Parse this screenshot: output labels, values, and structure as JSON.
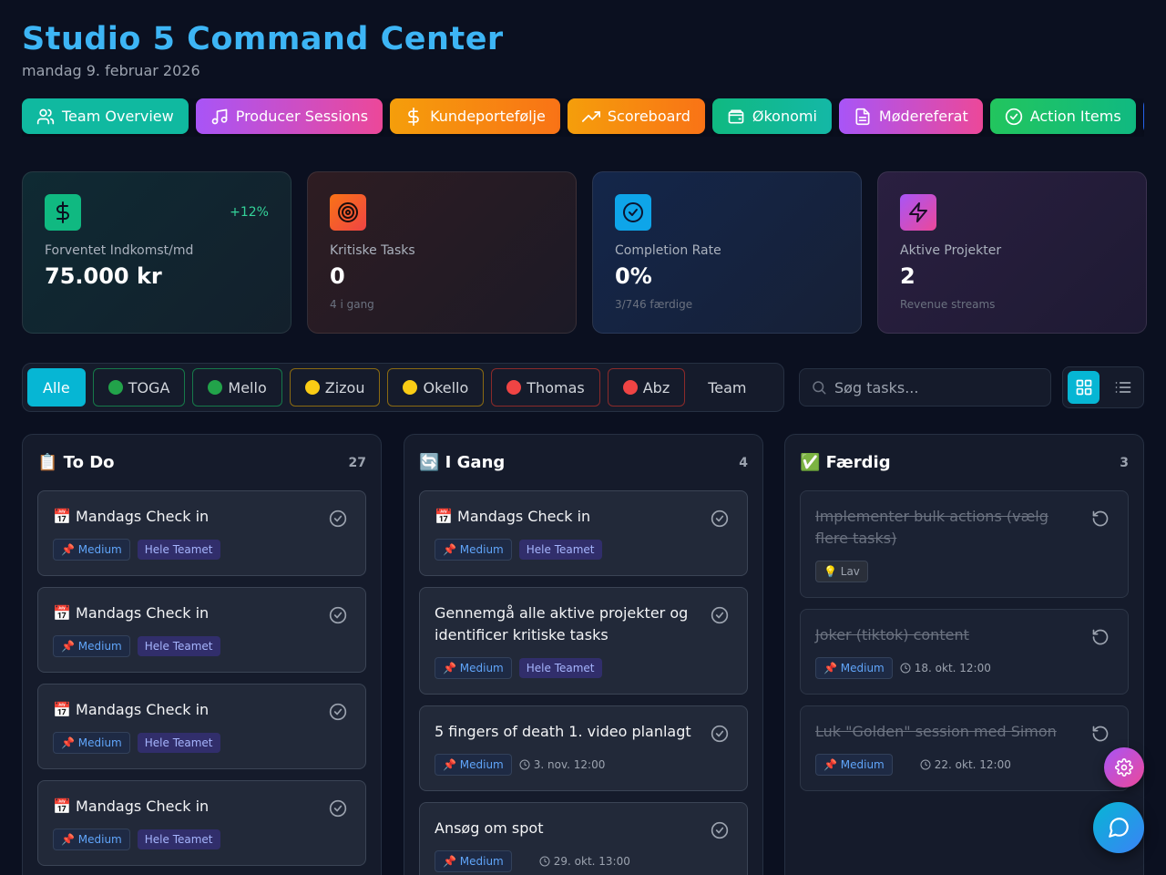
{
  "header": {
    "title": "Studio 5 Command Center",
    "date": "mandag 9. februar 2026"
  },
  "nav": [
    {
      "label": "Team Overview",
      "icon": "users-icon",
      "color": "#10b9a0"
    },
    {
      "label": "Producer Sessions",
      "icon": "music-icon",
      "color": "#b452e8"
    },
    {
      "label": "Kundeportefølje",
      "icon": "dollar-icon",
      "color": "#f97316"
    },
    {
      "label": "Scoreboard",
      "icon": "trending-up-icon",
      "color": "#f59e0b"
    },
    {
      "label": "Økonomi",
      "icon": "wallet-icon",
      "color": "#10b981"
    },
    {
      "label": "Mødereferat",
      "icon": "document-icon",
      "color": "#c44fe0"
    },
    {
      "label": "Action Items",
      "icon": "check-circle-icon",
      "color": "#16b45a"
    }
  ],
  "stats": [
    {
      "label": "Forventet Indkomst/md",
      "value": "75.000 kr",
      "delta": "+12%",
      "sub": "",
      "icon": "dollar-icon",
      "color": "#10b981"
    },
    {
      "label": "Kritiske Tasks",
      "value": "0",
      "delta": "",
      "sub": "4 i gang",
      "icon": "target-icon",
      "color": "#f97316"
    },
    {
      "label": "Completion Rate",
      "value": "0%",
      "delta": "",
      "sub": "3/746 færdige",
      "icon": "check-circle-icon",
      "color": "#0ea5e9"
    },
    {
      "label": "Aktive Projekter",
      "value": "2",
      "delta": "",
      "sub": "Revenue streams",
      "icon": "lightning-icon",
      "color": "#c044e8"
    }
  ],
  "filters": {
    "chips": [
      {
        "label": "Alle",
        "dot": ""
      },
      {
        "label": "TOGA",
        "dot": "green"
      },
      {
        "label": "Mello",
        "dot": "green"
      },
      {
        "label": "Zizou",
        "dot": "yellow"
      },
      {
        "label": "Okello",
        "dot": "yellow"
      },
      {
        "label": "Thomas",
        "dot": "red"
      },
      {
        "label": "Abz",
        "dot": "red"
      },
      {
        "label": "Team",
        "dot": ""
      }
    ],
    "search_placeholder": "Søg tasks..."
  },
  "columns": [
    {
      "title": "📋 To Do",
      "count": "27",
      "cards": [
        {
          "title": "📅 Mandags Check in",
          "prio": "📌 Medium",
          "team": "Hele Teamet"
        },
        {
          "title": "📅 Mandags Check in",
          "prio": "📌 Medium",
          "team": "Hele Teamet"
        },
        {
          "title": "📅 Mandags Check in",
          "prio": "📌 Medium",
          "team": "Hele Teamet"
        },
        {
          "title": "📅 Mandags Check in",
          "prio": "📌 Medium",
          "team": "Hele Teamet"
        }
      ]
    },
    {
      "title": "🔄 I Gang",
      "count": "4",
      "cards": [
        {
          "title": "📅 Mandags Check in",
          "prio": "📌 Medium",
          "team": "Hele Teamet"
        },
        {
          "title": "Gennemgå alle aktive projekter og identificer kritiske tasks",
          "prio": "📌 Medium",
          "team": "Hele Teamet"
        },
        {
          "title": "5 fingers of death 1. video planlagt",
          "prio": "📌 Medium",
          "date": "3. nov. 12:00"
        },
        {
          "title": "Ansøg om spot",
          "prio": "📌 Medium",
          "date": "29. okt. 13:00"
        }
      ]
    },
    {
      "title": "✅ Færdig",
      "count": "3",
      "cards": [
        {
          "title": "Implementer bulk actions (vælg flere tasks)",
          "prio": "💡 Lav"
        },
        {
          "title": "Joker (tiktok) content",
          "prio": "📌 Medium",
          "date": "18. okt. 12:00"
        },
        {
          "title": "Luk \"Golden\" session med Simon",
          "prio": "📌 Medium",
          "date": "22. okt. 12:00"
        }
      ]
    }
  ]
}
